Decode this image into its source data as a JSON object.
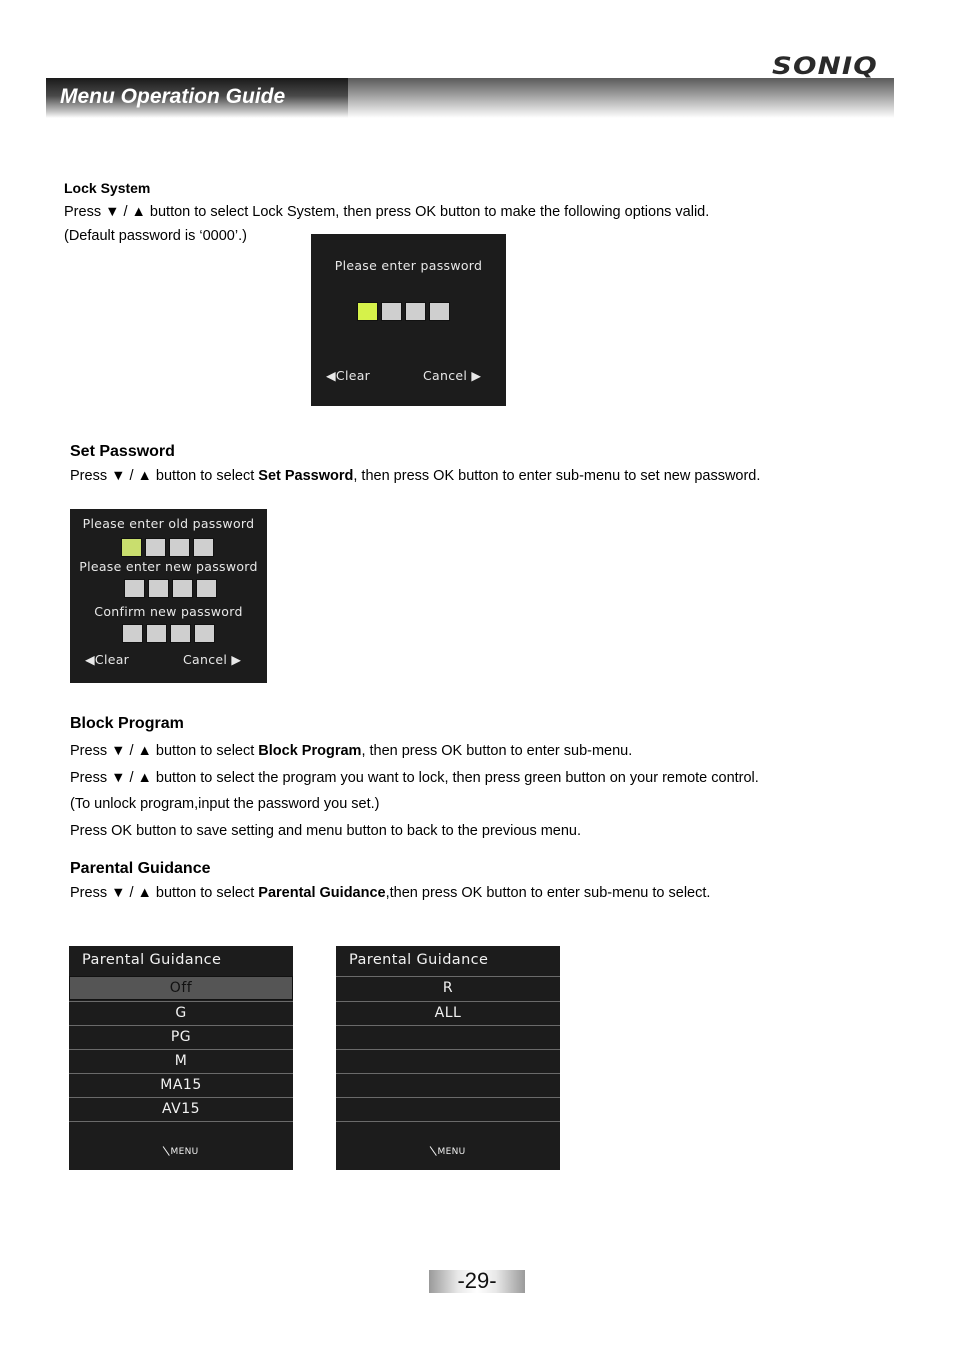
{
  "brand": {
    "logo": "SONIQ"
  },
  "header": {
    "title": "Menu Operation Guide"
  },
  "sections": {
    "lock_system": {
      "heading": "Lock System",
      "line1": "Press ▼ / ▲ button to select Lock System, then press OK button to make the following options valid.",
      "line2": "(Default password is ‘0000’.)"
    },
    "set_password": {
      "heading": "Set Password",
      "line1_pre": "Press ▼ / ▲ button to select ",
      "line1_bold": "Set Password",
      "line1_post": ", then press OK button to enter sub-menu to set new password."
    },
    "block_program": {
      "heading": "Block Program",
      "line1_pre": "Press ▼ / ▲ button to select ",
      "line1_bold": "Block Program",
      "line1_post": ", then press OK button to enter sub-menu.",
      "line2": "Press ▼ / ▲ button to select the program you want to lock, then press green button on your remote control.",
      "line3": "(To unlock program,input the  password you set.)",
      "line4": "Press OK button to save setting and menu button to back to the previous menu."
    },
    "parental_guidance": {
      "heading": "Parental Guidance",
      "line1_pre": "Press ▼ / ▲ button to select ",
      "line1_bold": "Parental Guidance",
      "line1_post": ",then press OK  button to enter sub-menu to select."
    }
  },
  "osd_lock": {
    "prompt": "Please enter password",
    "digits": 4,
    "active_digit": 1,
    "clear_label": "◀Clear",
    "cancel_label": "Cancel ▶"
  },
  "osd_setpw": {
    "old_prompt": "Please enter old password",
    "new_prompt": "Please enter new password",
    "confirm_prompt": "Confirm new password",
    "clear_label": "◀Clear",
    "cancel_label": "Cancel ▶"
  },
  "pg_menu_1": {
    "title": "Parental Guidance",
    "items": [
      "Off",
      "G",
      "PG",
      "M",
      "MA15",
      "AV15"
    ],
    "selected": "Off",
    "footer": "MENU"
  },
  "pg_menu_2": {
    "title": "Parental Guidance",
    "items": [
      "R",
      "ALL",
      "",
      "",
      "",
      ""
    ],
    "footer": "MENU"
  },
  "colors": {
    "active_digit": "#d6f24a",
    "osd_bg": "#1c1c1c"
  },
  "page": {
    "number": "-29-"
  }
}
